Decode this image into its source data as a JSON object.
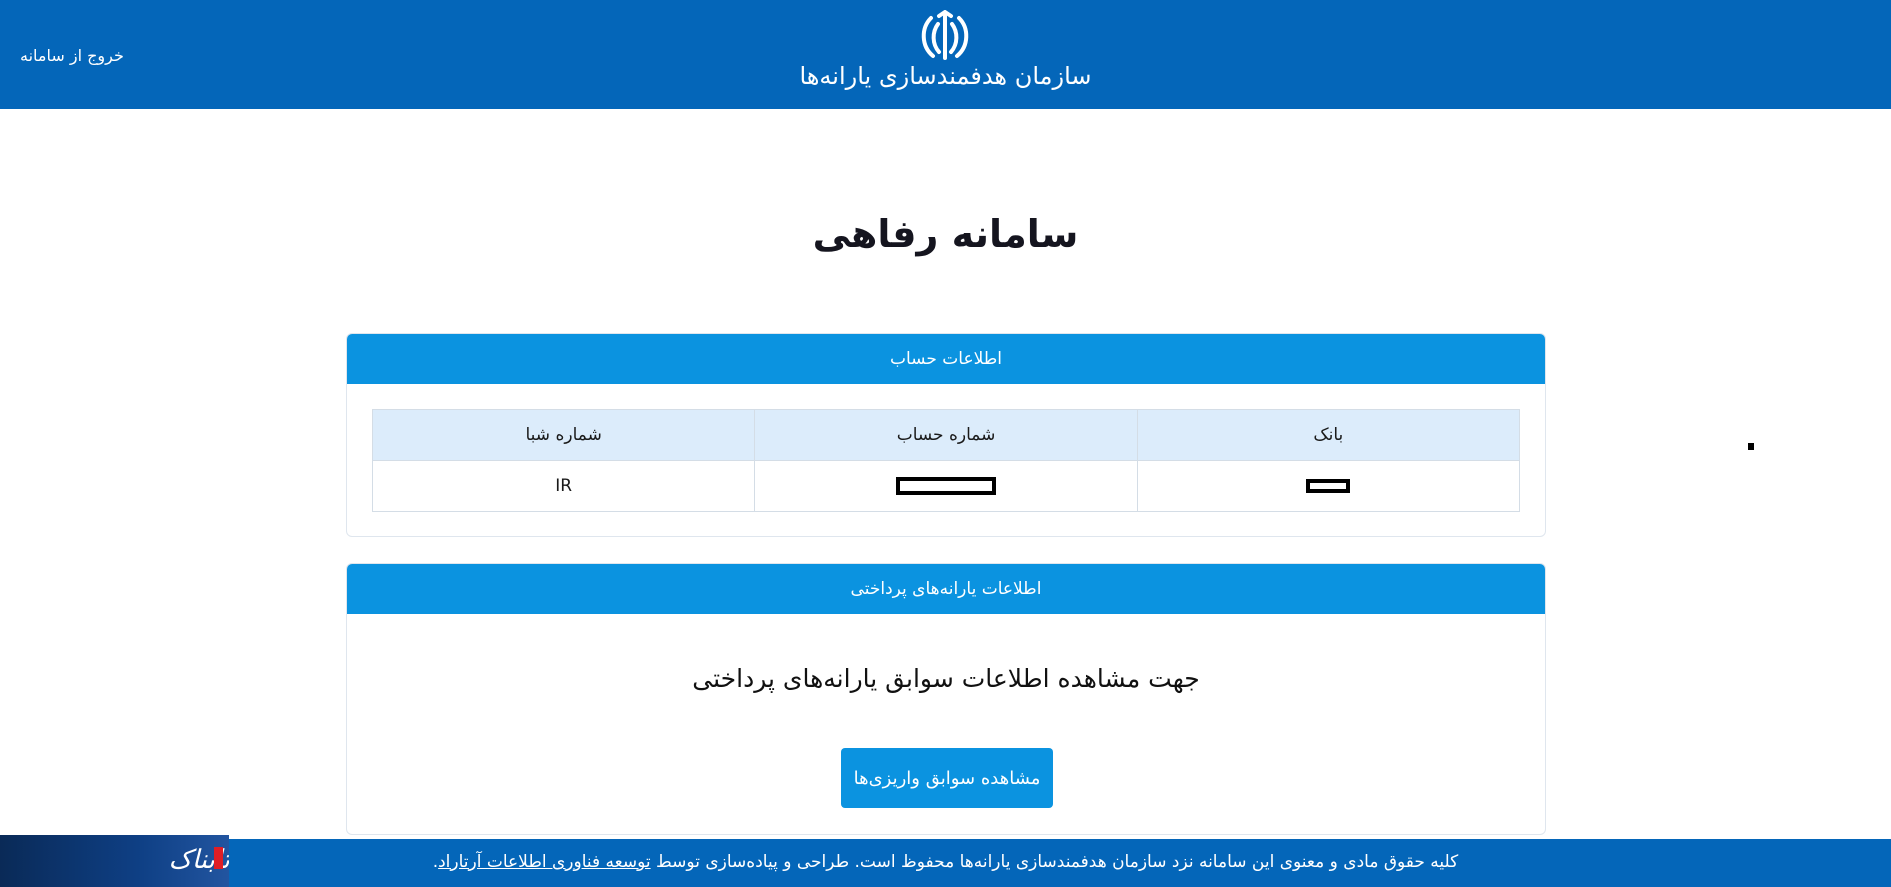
{
  "header": {
    "org_name": "سازمان هدفمندسازی یارانه‌ها",
    "logout_label": "خروج از سامانه",
    "emblem_icon": "iran-emblem-icon"
  },
  "page": {
    "title": "سامانه رفاهی"
  },
  "account_card": {
    "title": "اطلاعات حساب",
    "columns": [
      "بانک",
      "شماره حساب",
      "شماره شبا"
    ],
    "row": {
      "bank": "",
      "account_number": "",
      "sheba": "IR"
    }
  },
  "subsidy_card": {
    "title": "اطلاعات یارانه‌های پرداختی",
    "description": "جهت مشاهده اطلاعات سوابق یارانه‌های پرداختی",
    "button_label": "مشاهده سوابق واریزی‌ها"
  },
  "footer": {
    "text_prefix": "کلیه حقوق مادی و معنوی این سامانه نزد سازمان هدفمندسازی یارانه‌ها محفوظ است. طراحی و پیاده‌سازی توسط ",
    "link_text": "توسعه فناوری اطلاعات آرتاراد",
    "text_suffix": "."
  },
  "watermark": {
    "text": "تابناک"
  },
  "colors": {
    "header_blue": "#0466b9",
    "card_header_blue": "#0b93e0",
    "table_header_bg": "#dcecfb"
  }
}
